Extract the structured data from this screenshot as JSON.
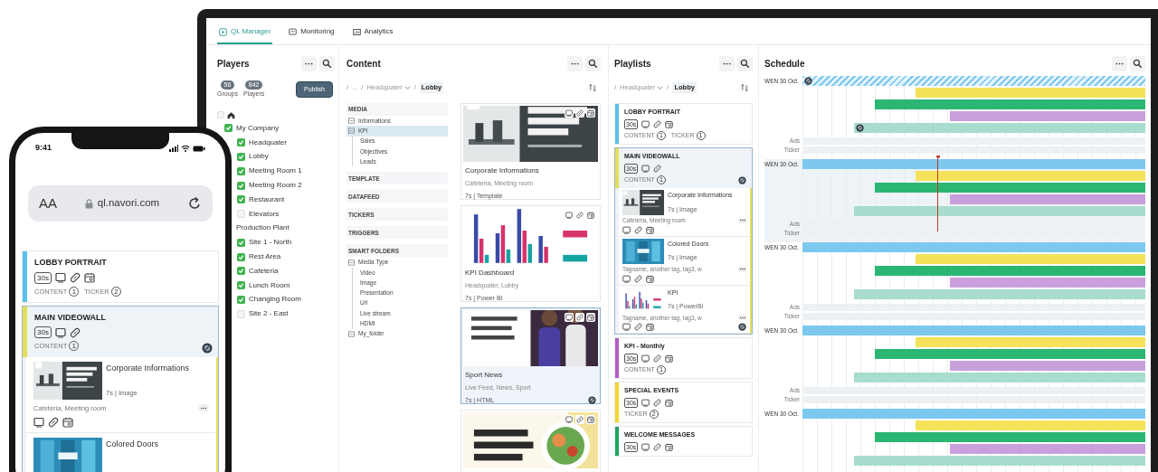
{
  "monitor": {
    "tabs": [
      {
        "label": "QL Manager",
        "selected": true
      },
      {
        "label": "Monitoring",
        "selected": false
      },
      {
        "label": "Analytics",
        "selected": false
      }
    ],
    "players": {
      "title": "Players",
      "counts": [
        {
          "value": "56",
          "label": "Groups"
        },
        {
          "value": "842",
          "label": "Players"
        }
      ],
      "publish_button": "Publish",
      "root_checked": false,
      "tree": [
        {
          "label": "My Company",
          "kind": "checkbox",
          "checked": true,
          "children": [
            {
              "label": "Headquater",
              "kind": "checkbox",
              "checked": true
            },
            {
              "label": "Lobby",
              "kind": "checkbox",
              "checked": true
            },
            {
              "label": "Meeting Room 1",
              "kind": "checkbox",
              "checked": true
            },
            {
              "label": "Meeting Room 2",
              "kind": "checkbox",
              "checked": true
            },
            {
              "label": "Restaurant",
              "kind": "checkbox",
              "checked": true
            },
            {
              "label": "Elevators",
              "kind": "checkbox",
              "checked": false
            }
          ]
        },
        {
          "label": "Production Plant",
          "kind": "label",
          "children": [
            {
              "label": "Site 1 - North",
              "kind": "checkbox",
              "checked": true
            },
            {
              "label": "Rest Area",
              "kind": "checkbox",
              "checked": true
            },
            {
              "label": "Cafeteria",
              "kind": "checkbox",
              "checked": true
            },
            {
              "label": "Lunch Room",
              "kind": "checkbox",
              "checked": true
            },
            {
              "label": "Changing Room",
              "kind": "checkbox",
              "checked": true
            },
            {
              "label": "Site 2 - East",
              "kind": "checkbox",
              "checked": false
            }
          ]
        }
      ]
    },
    "content": {
      "title": "Content",
      "separator": "/",
      "breadcrumb": [
        {
          "label": "...",
          "selected": false,
          "dropdown": false
        },
        {
          "label": "Headquater",
          "selected": false,
          "dropdown": true
        },
        {
          "label": "Lobby",
          "selected": true,
          "dropdown": false
        }
      ],
      "library": [
        {
          "title": "MEDIA",
          "items": [
            {
              "label": "Informations",
              "selected": false
            },
            {
              "label": "KPI",
              "selected": true,
              "children": [
                {
                  "label": "Sales",
                  "selected": false
                },
                {
                  "label": "Objectives",
                  "selected": false
                },
                {
                  "label": "Leads",
                  "selected": false
                }
              ]
            }
          ]
        },
        {
          "title": "TEMPLATE"
        },
        {
          "title": "DATAFEED"
        },
        {
          "title": "TICKERS"
        },
        {
          "title": "TRIGGERS"
        },
        {
          "title": "SMART FOLDERS",
          "items": [
            {
              "label": "Media Type",
              "selected": false,
              "children": [
                {
                  "label": "Video",
                  "selected": false
                },
                {
                  "label": "Image",
                  "selected": false
                },
                {
                  "label": "Presentation",
                  "selected": false
                },
                {
                  "label": "Url",
                  "selected": false
                },
                {
                  "label": "Live stream",
                  "selected": false
                },
                {
                  "label": "HDMI",
                  "selected": false
                }
              ]
            },
            {
              "label": "My_folder",
              "selected": false
            }
          ]
        }
      ],
      "cards": [
        {
          "title": "Corporate Informations",
          "tags": "Cafeteria, Meeting room",
          "meta": "7s | Template",
          "selected": false,
          "marked": false
        },
        {
          "title": "KPI Dashboard",
          "tags": "Headquater, Lobby",
          "meta": "7s | Power BI",
          "selected": false,
          "marked": false
        },
        {
          "title": "Sport News",
          "tags": "Live Feed, News, Sport",
          "meta": "7s | HTML",
          "selected": true,
          "marked": true
        },
        {
          "selected": false,
          "marked": false
        }
      ]
    },
    "playlists": {
      "title": "Playlists",
      "separator": "/",
      "breadcrumb": [
        {
          "label": "Headquater",
          "selected": false,
          "dropdown": true
        },
        {
          "label": "Lobby",
          "selected": true,
          "dropdown": false
        }
      ],
      "items": [
        {
          "title": "LOBBY PORTRAIT",
          "color": "#5bc0eb",
          "duration": "30s",
          "scheduled": true,
          "selected": false,
          "marked": false,
          "counters": [
            {
              "label": "CONTENT",
              "value": "1"
            },
            {
              "label": "TICKER",
              "value": "1"
            }
          ]
        },
        {
          "title": "MAIN VIDEOWALL",
          "color": "#e3df5c",
          "duration": "30s",
          "scheduled": false,
          "selected": true,
          "marked": true,
          "counters": [
            {
              "label": "CONTENT",
              "value": "1"
            }
          ],
          "children": [
            {
              "title": "Corporate Informations",
              "meta": "7s | Image",
              "tags": "Cafeteria, Meeting room",
              "marked": false
            },
            {
              "title": "Colored Doors",
              "meta": "7s | Image",
              "tags": "Tagname, another tag, tag3, w",
              "marked": false
            },
            {
              "title": "KPI",
              "meta": "7s | PowerBi",
              "tags": "Tagname, another tag, tag3, w",
              "marked": true
            }
          ]
        },
        {
          "title": "KPI - Monthly",
          "color": "#b45cc4",
          "duration": "30s",
          "scheduled": true,
          "selected": false,
          "marked": false,
          "counters": [
            {
              "label": "CONTENT",
              "value": "1"
            }
          ]
        },
        {
          "title": "SPECIAL EVENTS",
          "color": "#f2d530",
          "duration": "30s",
          "scheduled": true,
          "selected": false,
          "marked": false,
          "counters": [
            {
              "label": "TICKER",
              "value": "2"
            }
          ]
        },
        {
          "title": "WELCOME MESSAGES",
          "color": "#1fa463",
          "duration": "30s",
          "scheduled": true,
          "selected": false,
          "marked": false
        }
      ]
    },
    "schedule": {
      "title": "Schedule",
      "groups": [
        {
          "label": "WEN 30 Oct.",
          "current_time": false,
          "rows": [
            "Ads",
            "Ticker"
          ],
          "bars": [
            {
              "color": "#7cc8ef",
              "level": 1,
              "hatched": true,
              "marked": true
            },
            {
              "color": "#f4e35a",
              "level": 0.67,
              "hatched": false,
              "marked": false
            },
            {
              "color": "#2bb673",
              "level": 0.79,
              "hatched": false,
              "marked": false
            },
            {
              "color": "#c9a0dc",
              "level": 0.57,
              "hatched": false,
              "marked": false
            },
            {
              "color": "#a8dccf",
              "level": 0.85,
              "hatched": false,
              "marked": true
            }
          ]
        },
        {
          "label": "WEN 30 Oct.",
          "current_time": true,
          "rows": [
            "Ads",
            "Ticker"
          ],
          "bars": [
            {
              "color": "#7cc8ef",
              "level": 1,
              "hatched": false,
              "marked": false
            },
            {
              "color": "#f4e35a",
              "level": 0.67,
              "hatched": false,
              "marked": false
            },
            {
              "color": "#2bb673",
              "level": 0.79,
              "hatched": false,
              "marked": false
            },
            {
              "color": "#c9a0dc",
              "level": 0.57,
              "hatched": false,
              "marked": false
            },
            {
              "color": "#a8dccf",
              "level": 0.85,
              "hatched": false,
              "marked": false
            }
          ]
        },
        {
          "label": "WEN 30 Oct.",
          "current_time": false,
          "rows": [
            "Ads",
            "Ticker"
          ],
          "bars": [
            {
              "color": "#7cc8ef",
              "level": 1,
              "hatched": false,
              "marked": false
            },
            {
              "color": "#f4e35a",
              "level": 0.67,
              "hatched": false,
              "marked": false
            },
            {
              "color": "#2bb673",
              "level": 0.79,
              "hatched": false,
              "marked": false
            },
            {
              "color": "#c9a0dc",
              "level": 0.57,
              "hatched": false,
              "marked": false
            },
            {
              "color": "#a8dccf",
              "level": 0.85,
              "hatched": false,
              "marked": false
            }
          ]
        },
        {
          "label": "WEN 30 Oct.",
          "current_time": false,
          "rows": [
            "Ads",
            "Ticker"
          ],
          "bars": [
            {
              "color": "#7cc8ef",
              "level": 1,
              "hatched": false,
              "marked": false
            },
            {
              "color": "#f4e35a",
              "level": 0.67,
              "hatched": false,
              "marked": false
            },
            {
              "color": "#2bb673",
              "level": 0.79,
              "hatched": false,
              "marked": false
            },
            {
              "color": "#c9a0dc",
              "level": 0.57,
              "hatched": false,
              "marked": false
            },
            {
              "color": "#a8dccf",
              "level": 0.85,
              "hatched": false,
              "marked": false
            }
          ]
        },
        {
          "label": "WEN 30 Oct.",
          "current_time": false,
          "bars": [
            {
              "color": "#7cc8ef",
              "level": 1,
              "hatched": false,
              "marked": false
            },
            {
              "color": "#f4e35a",
              "level": 0.67,
              "hatched": false,
              "marked": false
            },
            {
              "color": "#2bb673",
              "level": 0.79,
              "hatched": false,
              "marked": false
            },
            {
              "color": "#c9a0dc",
              "level": 0.57,
              "hatched": false,
              "marked": false
            },
            {
              "color": "#a8dccf",
              "level": 0.85,
              "hatched": false,
              "marked": false
            }
          ]
        }
      ]
    }
  },
  "phone": {
    "time": "9:41",
    "text_size_button": "AA",
    "url": "ql.navori.com",
    "playlists": [
      {
        "title": "LOBBY PORTRAIT",
        "color": "#5bc0eb",
        "duration": "30s",
        "scheduled": true,
        "selected": false,
        "marked": false,
        "counters": [
          {
            "label": "CONTENT",
            "value": "1"
          },
          {
            "label": "TICKER",
            "value": "2"
          }
        ]
      },
      {
        "title": "MAIN VIDEOWALL",
        "color": "#e3df5c",
        "duration": "30s",
        "scheduled": false,
        "selected": true,
        "marked": true,
        "counters": [
          {
            "label": "CONTENT",
            "value": "1"
          }
        ],
        "children": [
          {
            "title": "Corporate Informations",
            "meta": "7s | Image",
            "tags": "Cafeteria, Meeting room",
            "marked": false
          },
          {
            "title": "Colored Doors"
          }
        ]
      }
    ]
  }
}
